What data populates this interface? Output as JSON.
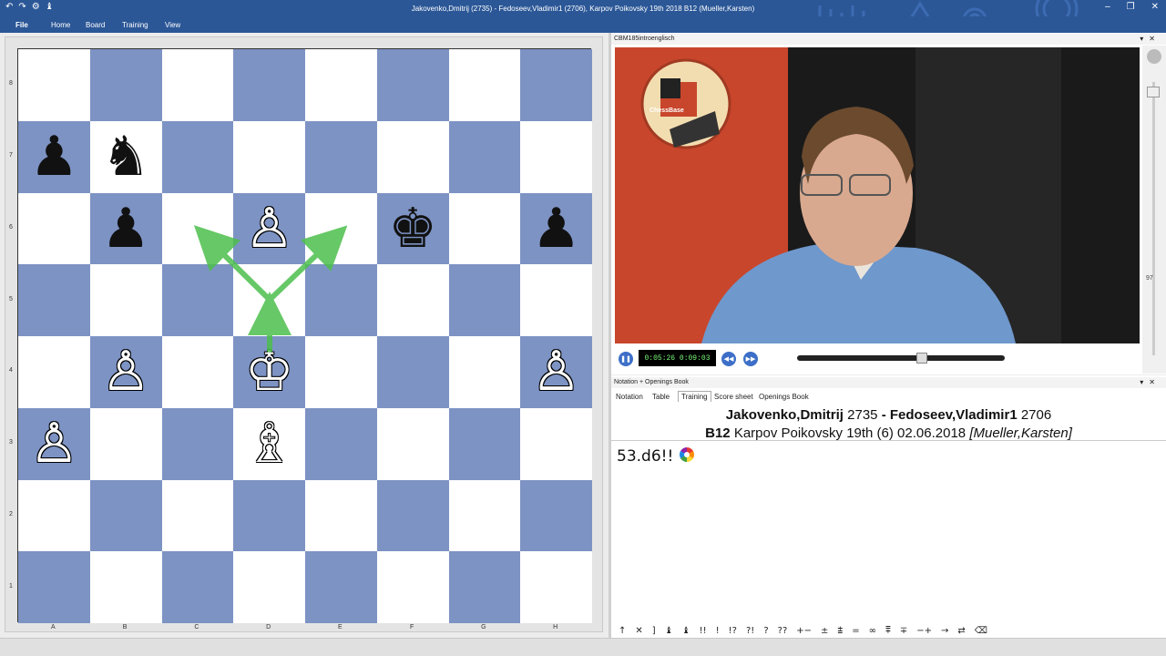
{
  "window": {
    "title": "Jakovenko,Dmitrij (2735) - Fedoseev,Vladimir1 (2706), Karpov Poikovsky 19th 2018  B12  (Mueller,Karsten)",
    "quick_access": [
      "↶",
      "↷",
      "⚙",
      "♝"
    ],
    "window_buttons": [
      "–",
      "❐",
      "✕"
    ]
  },
  "menu": [
    "File",
    "Home",
    "Board",
    "Training",
    "View"
  ],
  "board": {
    "ranks": [
      "8",
      "7",
      "6",
      "5",
      "4",
      "3",
      "2",
      "1"
    ],
    "files": [
      "A",
      "B",
      "C",
      "D",
      "E",
      "F",
      "G",
      "H"
    ],
    "pieces": [
      {
        "sq": "a7",
        "glyph": "♟",
        "color": "b",
        "name": "black-pawn-a7"
      },
      {
        "sq": "b7",
        "glyph": "♞",
        "color": "b",
        "name": "black-knight-b7"
      },
      {
        "sq": "b6",
        "glyph": "♟",
        "color": "b",
        "name": "black-pawn-b6"
      },
      {
        "sq": "d6",
        "glyph": "♙",
        "color": "w",
        "name": "white-pawn-d6"
      },
      {
        "sq": "f6",
        "glyph": "♚",
        "color": "b",
        "name": "black-king-f6"
      },
      {
        "sq": "h6",
        "glyph": "♟",
        "color": "b",
        "name": "black-pawn-h6"
      },
      {
        "sq": "b4",
        "glyph": "♙",
        "color": "w",
        "name": "white-pawn-b4"
      },
      {
        "sq": "d4",
        "glyph": "♔",
        "color": "w",
        "name": "white-king-d4"
      },
      {
        "sq": "h4",
        "glyph": "♙",
        "color": "w",
        "name": "white-pawn-h4"
      },
      {
        "sq": "a3",
        "glyph": "♙",
        "color": "w",
        "name": "white-pawn-a3"
      },
      {
        "sq": "d3",
        "glyph": "♗",
        "color": "w",
        "name": "white-bishop-d3"
      }
    ],
    "arrow_color": "#4cbf4c"
  },
  "video": {
    "panel_title": "CBM185introenglisch",
    "logo_text": "ChessBase",
    "time": "0:05:26  0:09:03",
    "progress": 0.6,
    "side_counter": "97"
  },
  "notation": {
    "panel_title": "Notation + Openings Book",
    "tabs": [
      "Notation",
      "Table",
      "Training",
      "Score sheet",
      "Openings Book"
    ],
    "active_tab": "Training",
    "white": "Jakovenko,Dmitrij",
    "white_elo": "2735",
    "dash": "-",
    "black": "Fedoseev,Vladimir1",
    "black_elo": "2706",
    "eco": "B12",
    "event": "Karpov Poikovsky 19th (6) 02.06.2018",
    "annotator": "[Mueller,Karsten]",
    "move": "53.d6!!",
    "symbols": [
      "↑",
      "✕",
      "]",
      "♝",
      "♝",
      "!!",
      "!",
      "!?",
      "?!",
      "?",
      "??",
      "+−",
      "±",
      "⩲",
      "=",
      "∞",
      "⩱",
      "∓",
      "−+",
      "→",
      "⇄",
      "⌫"
    ]
  }
}
